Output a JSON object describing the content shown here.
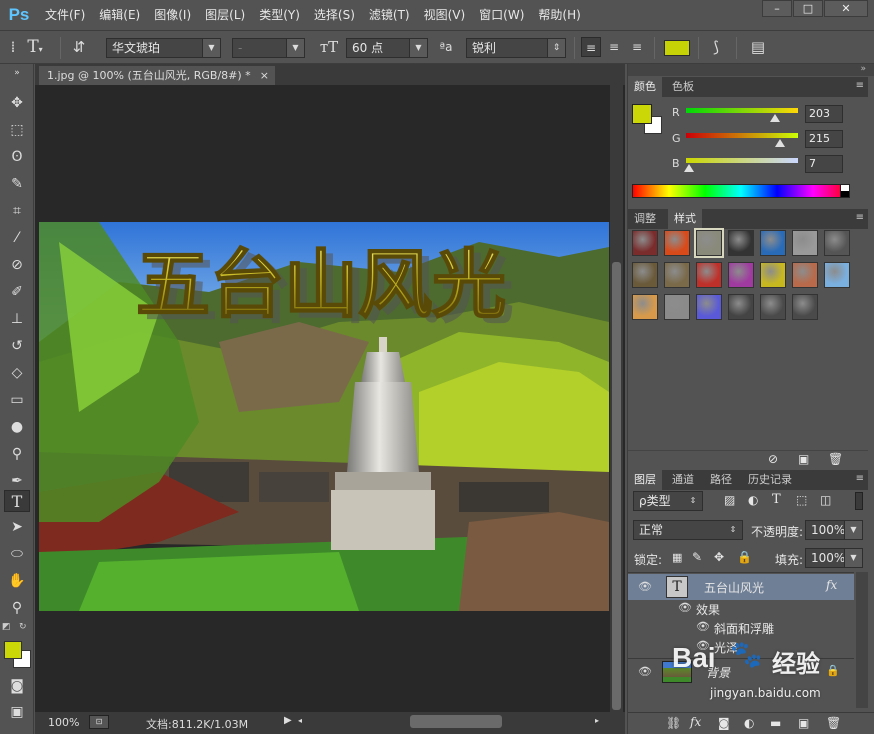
{
  "app": {
    "logo": "Ps"
  },
  "menu": [
    "文件(F)",
    "编辑(E)",
    "图像(I)",
    "图层(L)",
    "类型(Y)",
    "选择(S)",
    "滤镜(T)",
    "视图(V)",
    "窗口(W)",
    "帮助(H)"
  ],
  "window_controls": {
    "min": "–",
    "max": "□",
    "close": "✕"
  },
  "options": {
    "font_family": "华文琥珀",
    "font_style": "-",
    "font_size": "60 点",
    "aa_label": "ªa",
    "antialias": "锐利",
    "text_color": "#c6d106"
  },
  "document": {
    "tab_title": "1.jpg @ 100% (五台山风光, RGB/8#) *",
    "tab_close": "×",
    "headline": "五台山风光",
    "zoom": "100%",
    "doc_size": "文档:811.2K/1.03M"
  },
  "color_panel": {
    "tabs": [
      "颜色",
      "色板"
    ],
    "r_label": "R",
    "g_label": "G",
    "b_label": "B",
    "r": "203",
    "g": "215",
    "b": "7",
    "r_value": 203,
    "g_value": 215,
    "b_value": 7,
    "fg_color": "#cbd707",
    "bg_color": "#ffffff"
  },
  "styles_panel": {
    "tabs": [
      "调整",
      "样式"
    ],
    "swatches": [
      "#7a2b2b",
      "#d94a1a",
      "#8a8a7a",
      "#333333",
      "#2a6bb8",
      "#9a9a9a",
      "#555555",
      "#6a5a3a",
      "#7a6a4a",
      "#c0302a",
      "#a03aa0",
      "#c8b820",
      "#b86a4a",
      "#7ab0e0",
      "#d89a4a",
      "#8a8a8a",
      "#5a5ad8",
      "#444444",
      "#4a4a4a",
      "#4a4a4a"
    ]
  },
  "layers_panel": {
    "tabs": [
      "图层",
      "通道",
      "路径",
      "历史记录"
    ],
    "kind_filter": "ρ类型",
    "blend_mode": "正常",
    "opacity_label": "不透明度:",
    "opacity": "100%",
    "lock_label": "锁定:",
    "fill_label": "填充:",
    "fill": "100%",
    "layers": [
      {
        "name": "五台山风光",
        "type": "text",
        "fx": "fx"
      },
      {
        "name": "效果",
        "type": "effects-header"
      },
      {
        "name": "斜面和浮雕",
        "type": "effect"
      },
      {
        "name": "光泽",
        "type": "effect"
      },
      {
        "name": "背景",
        "type": "image"
      }
    ]
  },
  "watermark": {
    "brand": "Bai",
    "brand2": "经验",
    "url": "jingyan.baidu.com"
  }
}
